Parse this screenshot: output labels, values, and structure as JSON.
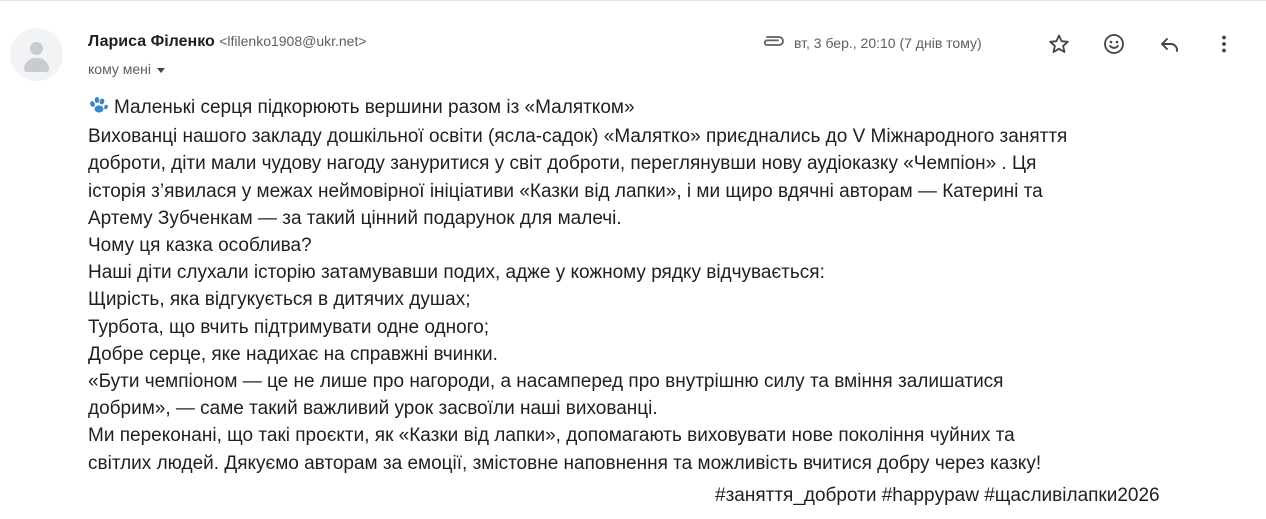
{
  "sender": {
    "name": "Лариса Філенко",
    "email": "<lfilenko1908@ukr.net>",
    "recipients": "кому мені"
  },
  "meta": {
    "date": "вт, 3 бер., 20:10 (7 днів тому)"
  },
  "icons": [
    "avatar-icon",
    "attachment-icon",
    "star-icon",
    "emoji-icon",
    "reply-icon",
    "more-vert-icon",
    "paw-icon",
    "chevron-down-icon"
  ],
  "body": {
    "title": "Маленькі серця підкорюють вершини разом із «Малятком»",
    "lines": [
      "Вихованці нашого закладу дошкільної освіти (ясла-садок) «Малятко» приєднались до V Міжнародного заняття",
      "доброти, діти мали чудову нагоду зануритися у світ доброти, переглянувши нову аудіоказку «Чемпіон» . Ця",
      "історія з’явилася у межах неймовірної ініціативи «Казки від лапки», і ми щиро вдячні авторам — Катерині та",
      "Артему Зубченкам — за такий цінний подарунок для малечі.",
      "Чому ця казка особлива?",
      "Наші діти слухали історію затамувавши подих, адже у кожному рядку відчувається:",
      "Щирість, яка відгукується в дитячих душах;",
      "Турбота, що вчить підтримувати одне одного;",
      "Добре серце, яке надихає на справжні вчинки.",
      "«Бути чемпіоном — це не лише про нагороди, а насамперед про внутрішню силу та вміння залишатися",
      "добрим», — саме такий важливий урок засвоїли наші вихованці.",
      "Ми переконані, що такі проєкти, як «Казки від лапки», допомагають виховувати нове покоління чуйних та",
      "світлих людей. Дякуємо авторам за емоції, змістовне наповнення та можливість вчитися добру через казку!"
    ],
    "tags": "#заняття_доброти #happypaw #щасливілапки2026"
  }
}
